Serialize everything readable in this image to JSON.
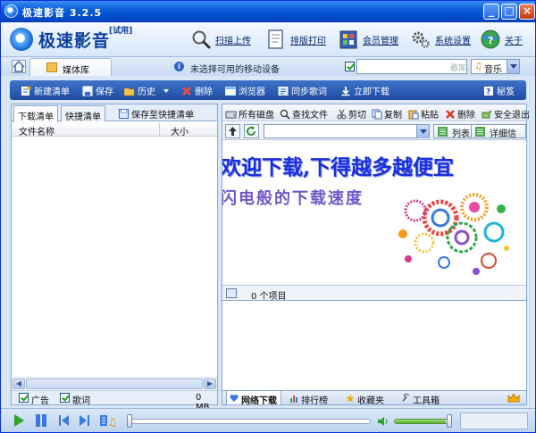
{
  "window": {
    "title": "极速影音 3.2.5",
    "minimize": "_",
    "maximize": "□",
    "close": "×"
  },
  "header": {
    "app_name": "极速影音",
    "trial_badge": "[试用]",
    "buttons": [
      {
        "label": "扫描上传",
        "icon": "magnifier-icon"
      },
      {
        "label": "排版打印",
        "icon": "document-icon"
      },
      {
        "label": "会员管理",
        "icon": "member-book-icon"
      },
      {
        "label": "系统设置",
        "icon": "gear-icon"
      },
      {
        "label": "关于",
        "icon": "globe-help-icon"
      }
    ]
  },
  "tabrow": {
    "media_tab": "媒体库",
    "notice": "未选择可用的移动设备",
    "notice_icon": "i",
    "search_value": "",
    "search_hint": "歌库",
    "category": "音乐",
    "category_icon": "♫"
  },
  "toolbar": {
    "new_list": "新建清单",
    "save": "保存",
    "history": "历史",
    "delete": "删除",
    "browser": "浏览器",
    "sync_lyrics": "同步歌词",
    "download_now": "立即下载",
    "help": "秘笈"
  },
  "left": {
    "tabs": [
      "下载清单",
      "快捷清单"
    ],
    "save_quick": "保存至快捷清单",
    "columns": {
      "name": "文件名称",
      "size": "大小"
    },
    "status": {
      "ads": "广告",
      "lyrics": "歌词",
      "size": "0 MB"
    }
  },
  "right": {
    "toolbar": {
      "all_disks": "所有磁盘",
      "find_file": "查找文件",
      "cut": "剪切",
      "copy": "复制",
      "paste": "粘贴",
      "delete": "删除",
      "safe_remove": "安全退出"
    },
    "nav": {
      "path": "",
      "list_view": "列表",
      "detail_view": "详细信息"
    },
    "banner": {
      "line1": "欢迎下载,下得越多越便宜",
      "line2": "闪电般的下载速度"
    },
    "items_count": "0 个项目",
    "bottom_tabs": [
      "网络下载",
      "排行榜",
      "收藏夹",
      "工具箱"
    ]
  },
  "player": {
    "progress": 0,
    "volume": 0.95
  },
  "colors": {
    "accent": "#2b5cb3",
    "titlebar": "#0a5fd8",
    "banner_blue": "#1b2fd8",
    "banner_purple": "#6f57c9"
  }
}
